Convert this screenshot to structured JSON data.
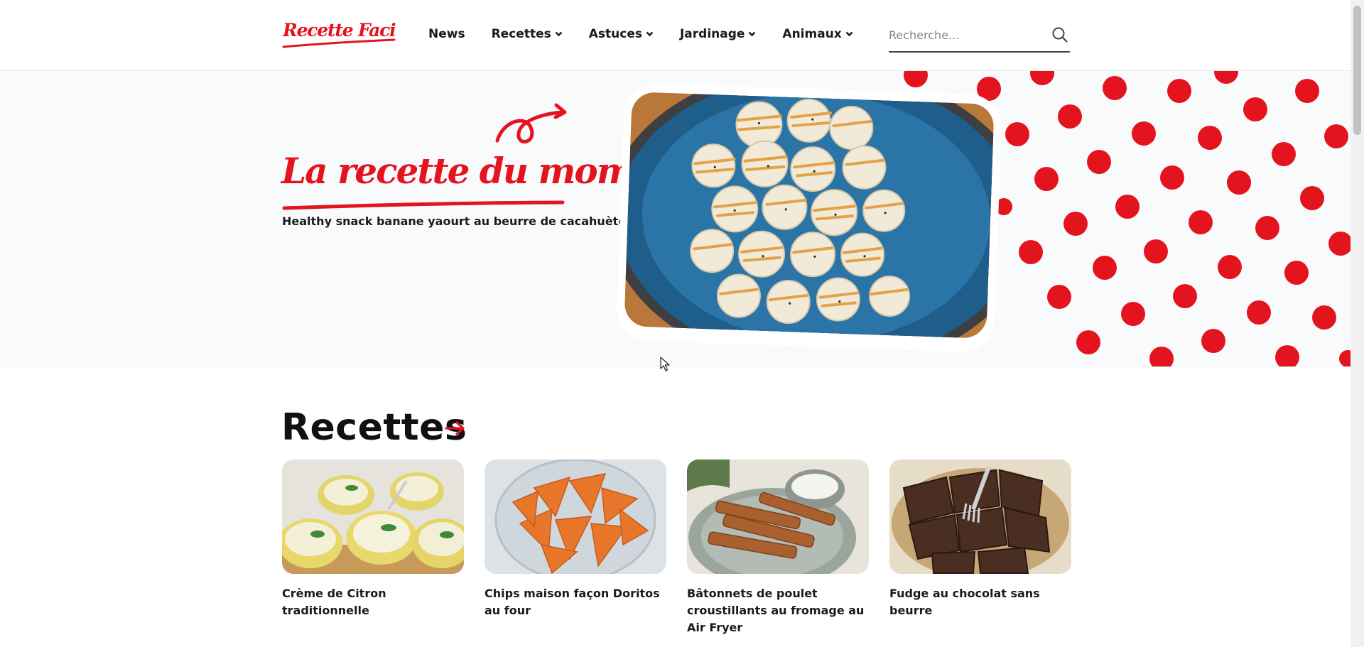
{
  "header": {
    "logo_text": "Recette Facile",
    "nav": [
      {
        "label": "News",
        "has_dropdown": false
      },
      {
        "label": "Recettes",
        "has_dropdown": true
      },
      {
        "label": "Astuces",
        "has_dropdown": true
      },
      {
        "label": "Jardinage",
        "has_dropdown": true
      },
      {
        "label": "Animaux",
        "has_dropdown": true
      }
    ],
    "search": {
      "placeholder": "Recherche...",
      "value": "",
      "icon": "search-icon"
    }
  },
  "hero": {
    "title": "La recette du moment !",
    "subtitle": "Healthy snack banane yaourt au beurre de cacahuètes"
  },
  "recipes_section": {
    "title": "Recettes",
    "cards": [
      {
        "title": "Crème de Citron traditionnelle"
      },
      {
        "title": "Chips maison façon Doritos au four"
      },
      {
        "title": "Bâtonnets de poulet croustillants au fromage au Air Fryer"
      },
      {
        "title": "Fudge au chocolat sans beurre"
      }
    ]
  },
  "colors": {
    "accent": "#e4141f",
    "hero_bg": "#f8fafb",
    "text": "#1a1a1a"
  }
}
